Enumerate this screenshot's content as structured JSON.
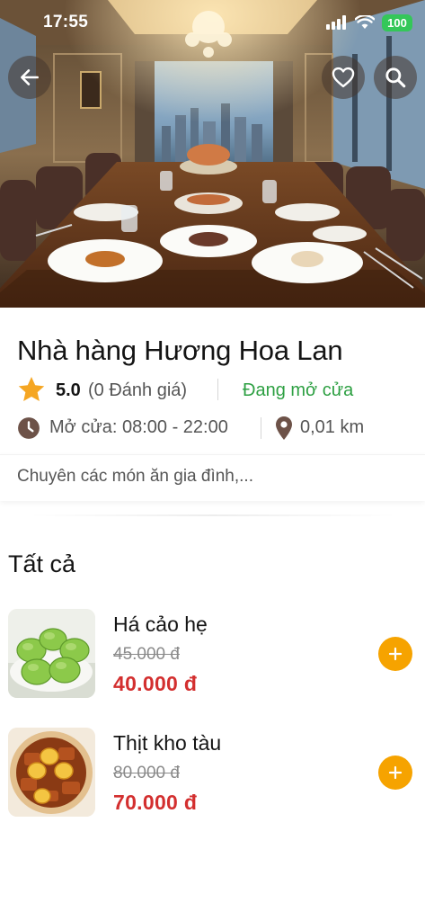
{
  "status_bar": {
    "time": "17:55",
    "battery": "100",
    "icons": [
      "signal-icon",
      "wifi-icon",
      "battery-icon"
    ]
  },
  "header": {
    "back_icon": "arrow-left-icon",
    "favorite_icon": "heart-icon",
    "search_icon": "search-icon"
  },
  "restaurant": {
    "name": "Nhà hàng Hương Hoa Lan",
    "rating": "5.0",
    "review_count": "(0 Đánh giá)",
    "open_status": "Đang mở cửa",
    "hours": "Mở cửa: 08:00 - 22:00",
    "distance": "0,01 km",
    "description": "Chuyên các món ăn gia đình,..."
  },
  "menu": {
    "section_title": "Tất cả",
    "items": [
      {
        "name": "Há cảo hẹ",
        "old_price": "45.000  đ",
        "price": "40.000  đ",
        "image": "har-gow-chives-dumplings"
      },
      {
        "name": "Thịt kho tàu",
        "old_price": "80.000  đ",
        "price": "70.000  đ",
        "image": "braised-pork-with-eggs"
      }
    ]
  },
  "colors": {
    "accent": "#f6a300",
    "price": "#d32f2f",
    "open": "#2ea043",
    "icon_brown": "#6d5248",
    "star": "#f5a623",
    "battery": "#34c759"
  }
}
